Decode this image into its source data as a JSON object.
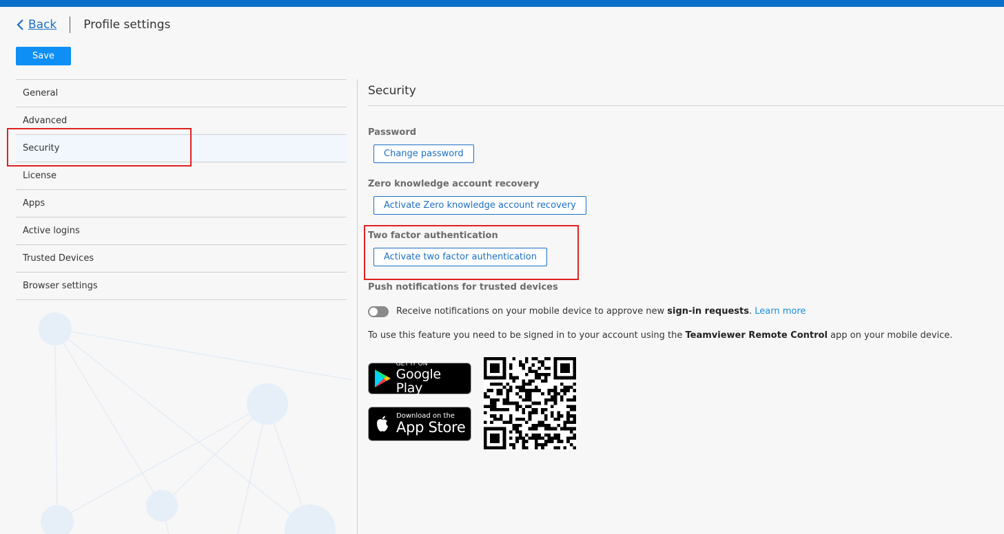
{
  "header": {
    "back_label": "Back",
    "title": "Profile settings"
  },
  "toolbar": {
    "save_label": "Save"
  },
  "sidebar": {
    "items": [
      {
        "label": "General"
      },
      {
        "label": "Advanced"
      },
      {
        "label": "Security"
      },
      {
        "label": "License"
      },
      {
        "label": "Apps"
      },
      {
        "label": "Active logins"
      },
      {
        "label": "Trusted Devices"
      },
      {
        "label": "Browser settings"
      }
    ],
    "active": "Security"
  },
  "main": {
    "section_title": "Security",
    "password": {
      "label": "Password",
      "button": "Change password"
    },
    "zero_knowledge": {
      "label": "Zero knowledge account recovery",
      "button": "Activate Zero knowledge account recovery"
    },
    "two_factor": {
      "label": "Two factor authentication",
      "button": "Activate two factor authentication"
    },
    "push": {
      "label": "Push notifications for trusted devices",
      "text_before": "Receive notifications on your mobile device to approve new ",
      "text_bold": "sign-in requests",
      "text_after": ". ",
      "learn_more": "Learn more",
      "toggle_on": false
    },
    "info": {
      "text_before": "To use this feature you need to be signed in to your account using the ",
      "text_bold": "Teamviewer Remote Control",
      "text_after": " app on your mobile device."
    },
    "badges": {
      "google_small": "GET IT ON",
      "google_big": "Google Play",
      "apple_small": "Download on the",
      "apple_big": "App Store"
    }
  },
  "colors": {
    "accent": "#0a6ecb",
    "primary_button": "#0e8ff5",
    "link": "#1a6fc4",
    "highlight": "#e02020"
  }
}
